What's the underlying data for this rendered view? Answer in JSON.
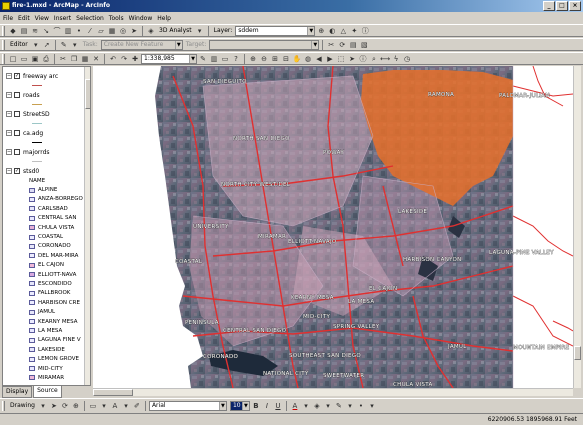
{
  "window": {
    "title": "fire-1.mxd - ArcMap - ArcInfo",
    "buttons": {
      "minimize": "_",
      "maximize": "□",
      "close": "×"
    }
  },
  "menu": [
    "File",
    "Edit",
    "View",
    "Insert",
    "Selection",
    "Tools",
    "Window",
    "Help"
  ],
  "toolbar1": {
    "analyst_label": "3D Analyst",
    "layer_label": "Layer:",
    "layer_value": "sddem"
  },
  "toolbar2": {
    "editor_label": "Editor",
    "task_label": "Task:",
    "task_value": "Create New Feature",
    "target_label": "Target:"
  },
  "toolbar3": {
    "scale_value": "1:338,985"
  },
  "toc": {
    "layers": [
      {
        "name": "freeway arc",
        "checked": true,
        "line_color": "#c0504d"
      },
      {
        "name": "roads",
        "checked": false,
        "line_color": "#c8a050"
      },
      {
        "name": "StreetSD",
        "checked": false,
        "line_color": "#9cc7c7"
      },
      {
        "name": "ca.adg",
        "checked": false,
        "line_color": "#000000"
      },
      {
        "name": "majorrds",
        "checked": false,
        "line_color": "#c0c0c0"
      },
      {
        "name": "stsd0",
        "checked": true,
        "line_color": ""
      }
    ],
    "field_name": "NAME",
    "legend": [
      {
        "label": "ALPINE",
        "color": "#dcdcf5"
      },
      {
        "label": "ANZA-BORREGO",
        "color": "#ececff"
      },
      {
        "label": "CARLSBAD",
        "color": "#e6e6fa"
      },
      {
        "label": "CENTRAL SAN",
        "color": "#e8e8ff"
      },
      {
        "label": "CHULA VISTA",
        "color": "#e8b0d8"
      },
      {
        "label": "COASTAL",
        "color": "#ececff"
      },
      {
        "label": "CORONADO",
        "color": "#e6e6fa"
      },
      {
        "label": "DEL MAR-MIRA",
        "color": "#ececff"
      },
      {
        "label": "EL CAJON",
        "color": "#f0b8d8"
      },
      {
        "label": "ELLIOTT-NAVA",
        "color": "#d8a8e0"
      },
      {
        "label": "ESCONDIDO",
        "color": "#e6e6fa"
      },
      {
        "label": "FALLBROOK",
        "color": "#ececff"
      },
      {
        "label": "HARBISON CRE",
        "color": "#ececff"
      },
      {
        "label": "JAMUL",
        "color": "#e6e6fa"
      },
      {
        "label": "KEARNY MESA",
        "color": "#ececff"
      },
      {
        "label": "LA MESA",
        "color": "#e8e8ff"
      },
      {
        "label": "LAGUNA FINE V",
        "color": "#ececff"
      },
      {
        "label": "LAKESIDE",
        "color": "#e6e6fa"
      },
      {
        "label": "LEMON GROVE",
        "color": "#ececff"
      },
      {
        "label": "MID-CITY",
        "color": "#e8e8ff"
      },
      {
        "label": "MIRAMAR",
        "color": "#f0b8d8"
      }
    ],
    "tabs": [
      "Display",
      "Source"
    ]
  },
  "map": {
    "labels": [
      "PALOMAR-JULIAN",
      "RAMONA",
      "SAN DIEGUITO",
      "NORTH SAN DIEGO",
      "POWAY",
      "LAGUNA-PINE VALLEY",
      "NORTH CITY WEST/DEL",
      "LAKESIDE",
      "UNIVERSITY",
      "MIRAMAR",
      "ELLIOTT-NAVAJO",
      "HARBISON CANYON",
      "COASTAL",
      "KEARNY MESA",
      "EL CAJON",
      "PENINSULA",
      "MID-CITY",
      "LA MESA",
      "CENTRAL SAN DIEGO",
      "SPRING VALLEY",
      "JAMUL",
      "MOUNTAIN EMPIRE",
      "CORONADO",
      "SOUTHEAST SAN DIEGO",
      "NATIONAL CITY",
      "SWEETWATER",
      "CHULA VISTA"
    ],
    "fire_color": "#e8702a",
    "road_color": "#e03030"
  },
  "drawing": {
    "drawing_label": "Drawing",
    "font_name": "Arial",
    "font_size": "10",
    "bold": "B",
    "italic": "I",
    "underline": "U",
    "text_tool": "A"
  },
  "status": {
    "coordinates": "6220906.53  1895968.91 Feet"
  }
}
